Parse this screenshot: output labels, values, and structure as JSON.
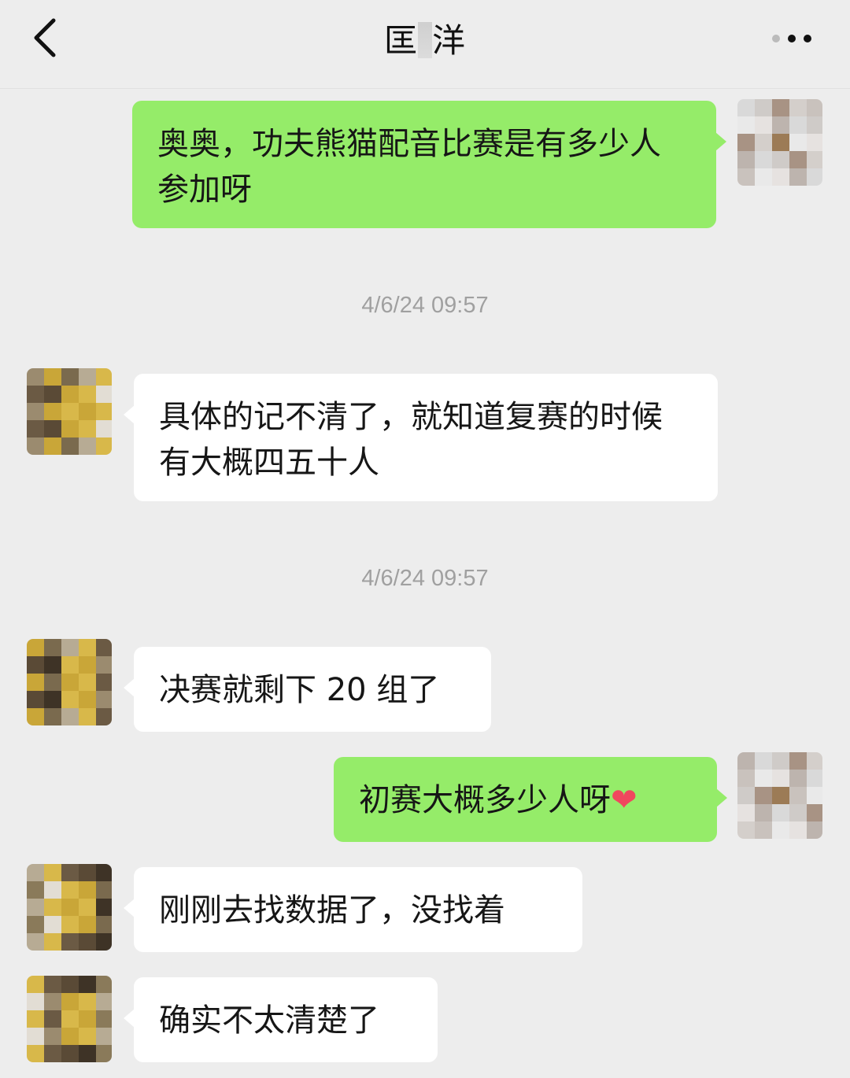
{
  "header": {
    "title_left": "匡",
    "title_right": "洋",
    "back_icon": "chevron-left-icon",
    "more_icon": "more-dots-icon"
  },
  "messages": [
    {
      "side": "me",
      "text": "奥奥，功夫熊猫配音比赛是有多少人参加呀"
    },
    {
      "side": "time",
      "text": "4/6/24 09:57"
    },
    {
      "side": "them",
      "text": "具体的记不清了，就知道复赛的时候有大概四五十人"
    },
    {
      "side": "time",
      "text": "4/6/24 09:57"
    },
    {
      "side": "them",
      "text": "决赛就剩下 20 组了"
    },
    {
      "side": "me",
      "text": "初赛大概多少人呀",
      "emoji": "❤"
    },
    {
      "side": "them",
      "text": "刚刚去找数据了，没找着"
    },
    {
      "side": "them",
      "text": "确实不太清楚了"
    }
  ],
  "colors": {
    "background": "#ededed",
    "me_bubble": "#95ec69",
    "them_bubble": "#ffffff",
    "timestamp": "#a0a0a0"
  }
}
